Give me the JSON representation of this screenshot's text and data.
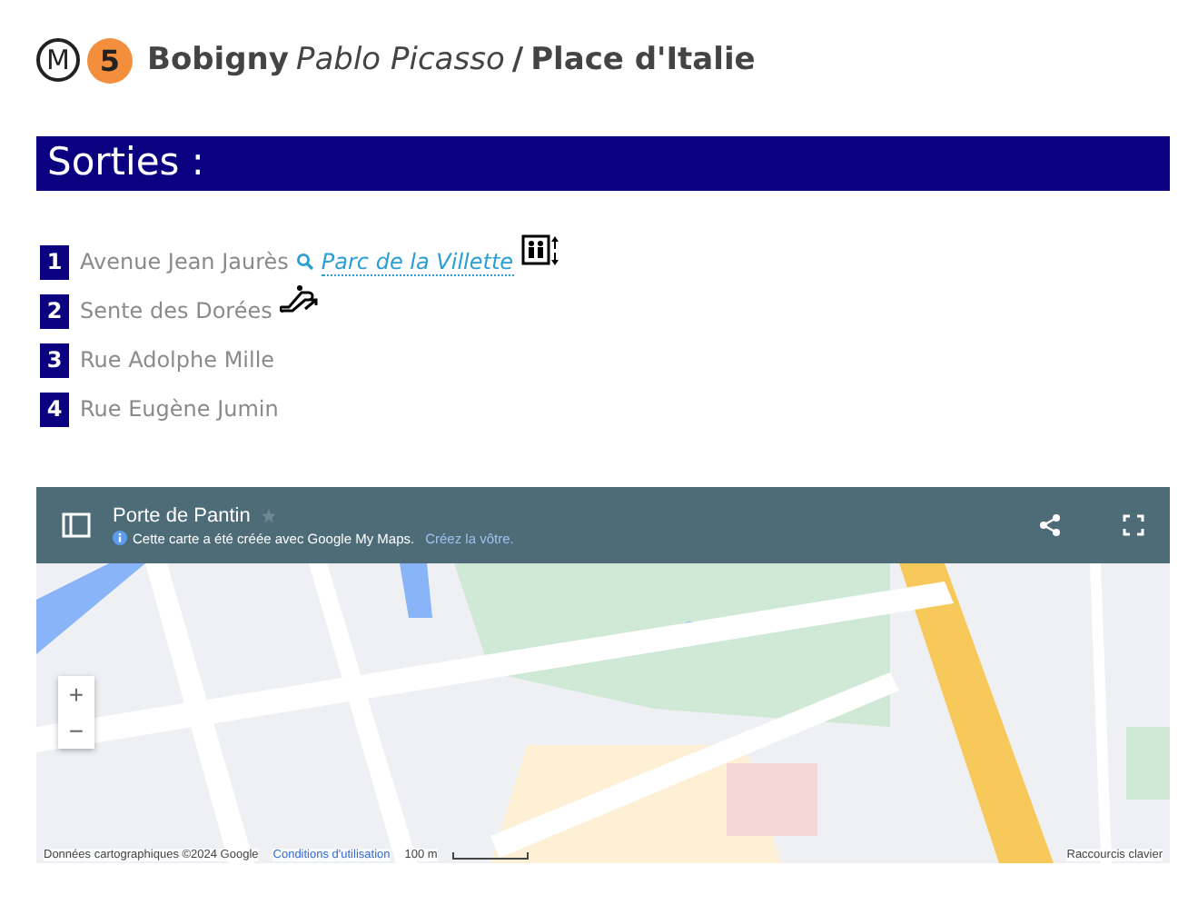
{
  "header": {
    "network_badge": "M",
    "line_badge": "5",
    "terminus_a": "Bobigny",
    "terminus_a_sub": "Pablo Picasso",
    "separator": "/",
    "terminus_b": "Place d'Italie"
  },
  "section_title": "Sorties :",
  "exits": [
    {
      "number": "1",
      "street": "Avenue Jean Jaurès",
      "link": "Parc de la Villette",
      "kind": "elevator"
    },
    {
      "number": "2",
      "street": "Sente des Dorées",
      "kind": "escalator"
    },
    {
      "number": "3",
      "street": "Rue Adolphe Mille",
      "kind": "plain"
    },
    {
      "number": "4",
      "street": "Rue Eugène Jumin",
      "kind": "plain"
    }
  ],
  "map": {
    "title": "Porte de Pantin",
    "notice": "Cette carte a été créée avec Google My Maps.",
    "notice_link": "Créez la vôtre.",
    "zoom_in": "+",
    "zoom_out": "−",
    "attribution": "Données cartographiques ©2024 Google",
    "terms": "Conditions d'utilisation",
    "scale": "100 m",
    "shortcuts": "Raccourcis clavier"
  }
}
